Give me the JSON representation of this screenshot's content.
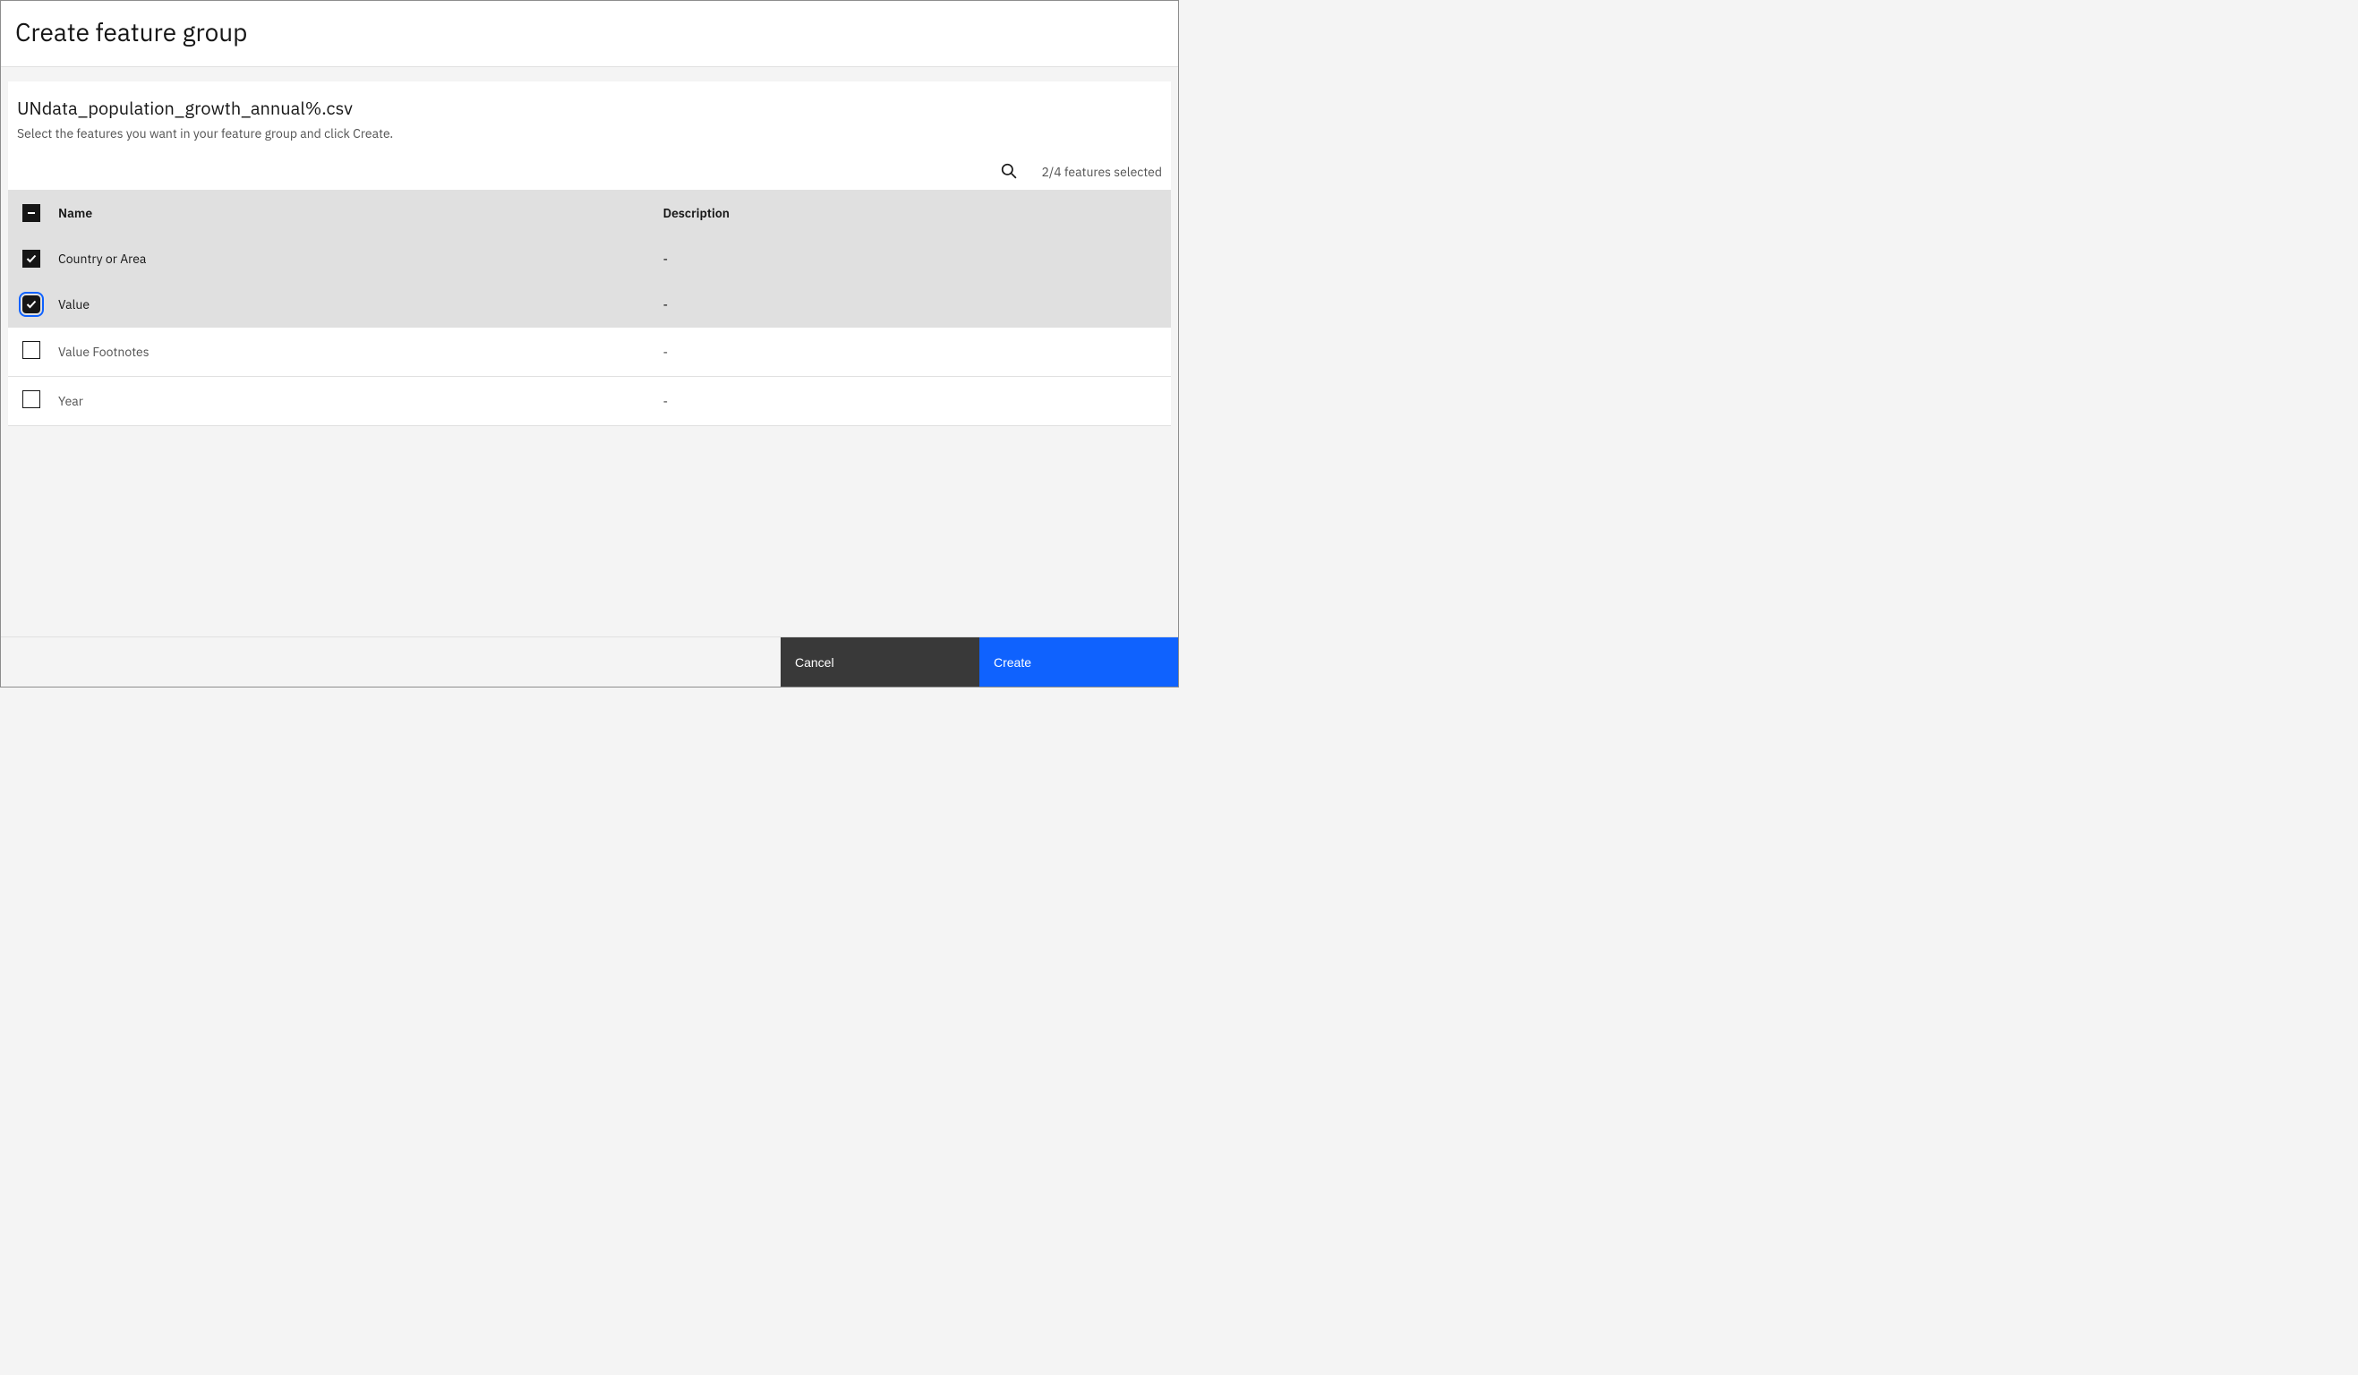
{
  "header": {
    "title": "Create feature group"
  },
  "card": {
    "filename": "UNdata_population_growth_annual%.csv",
    "instruction": "Select the features you want in your feature group and click Create."
  },
  "toolbar": {
    "selected_status": "2/4 features selected"
  },
  "table": {
    "columns": {
      "name": "Name",
      "description": "Description"
    },
    "rows": [
      {
        "name": "Country or Area",
        "description": "-",
        "checked": true,
        "focused": false
      },
      {
        "name": "Value",
        "description": "-",
        "checked": true,
        "focused": true
      },
      {
        "name": "Value Footnotes",
        "description": "-",
        "checked": false,
        "focused": false
      },
      {
        "name": "Year",
        "description": "-",
        "checked": false,
        "focused": false
      }
    ]
  },
  "footer": {
    "cancel": "Cancel",
    "create": "Create"
  }
}
